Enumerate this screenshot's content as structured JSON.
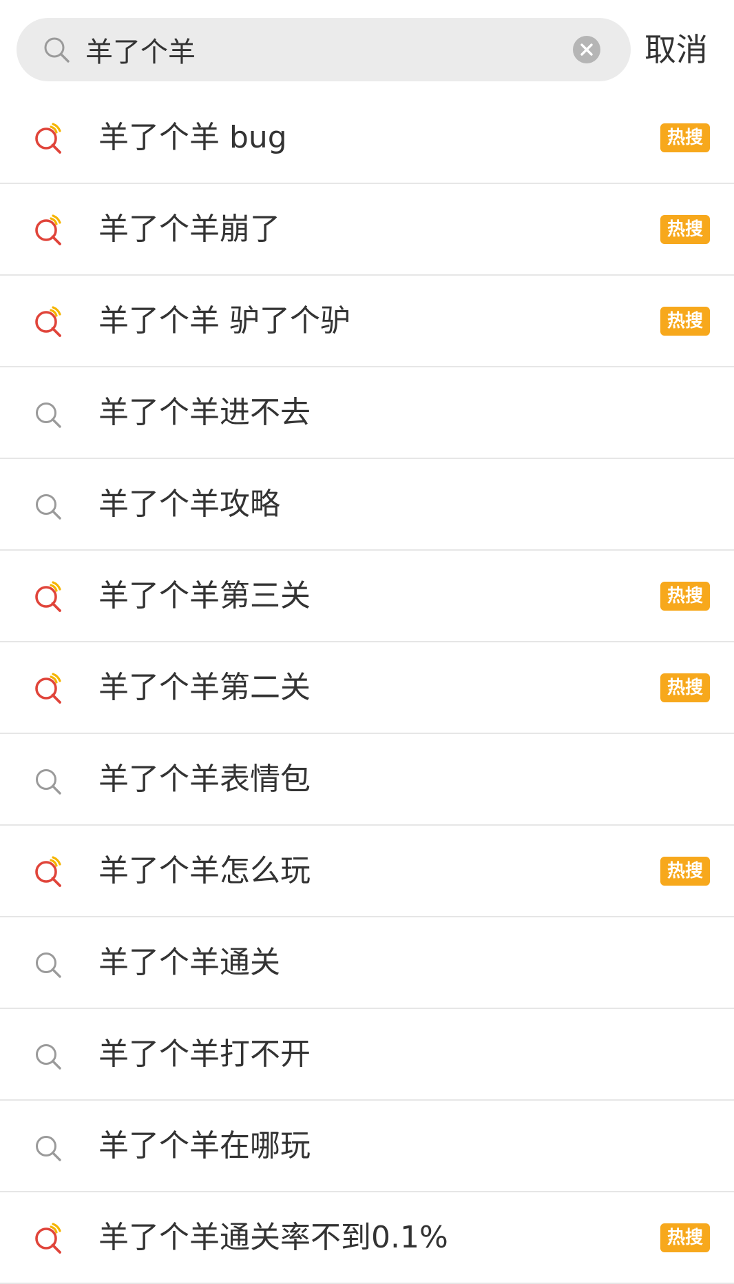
{
  "search": {
    "value": "羊了个羊",
    "cancel_label": "取消"
  },
  "colors": {
    "hot_badge": "#f7a81c",
    "hot_icon_red": "#e0443a",
    "hot_icon_yellow": "#f5b400",
    "plain_icon": "#9a9a9a",
    "caret": "#1a73b8"
  },
  "suggestions": [
    {
      "text": "羊了个羊 bug",
      "icon": "hot-search-icon",
      "badge": "热搜"
    },
    {
      "text": "羊了个羊崩了",
      "icon": "hot-search-icon",
      "badge": "热搜"
    },
    {
      "text": "羊了个羊 驴了个驴",
      "icon": "hot-search-icon",
      "badge": "热搜"
    },
    {
      "text": "羊了个羊进不去",
      "icon": "search-icon",
      "badge": ""
    },
    {
      "text": "羊了个羊攻略",
      "icon": "search-icon",
      "badge": ""
    },
    {
      "text": "羊了个羊第三关",
      "icon": "hot-search-icon",
      "badge": "热搜"
    },
    {
      "text": "羊了个羊第二关",
      "icon": "hot-search-icon",
      "badge": "热搜"
    },
    {
      "text": "羊了个羊表情包",
      "icon": "search-icon",
      "badge": ""
    },
    {
      "text": "羊了个羊怎么玩",
      "icon": "hot-search-icon",
      "badge": "热搜"
    },
    {
      "text": "羊了个羊通关",
      "icon": "search-icon",
      "badge": ""
    },
    {
      "text": "羊了个羊打不开",
      "icon": "search-icon",
      "badge": ""
    },
    {
      "text": "羊了个羊在哪玩",
      "icon": "search-icon",
      "badge": ""
    },
    {
      "text": "羊了个羊通关率不到0.1%",
      "icon": "hot-search-icon",
      "badge": "热搜"
    }
  ]
}
